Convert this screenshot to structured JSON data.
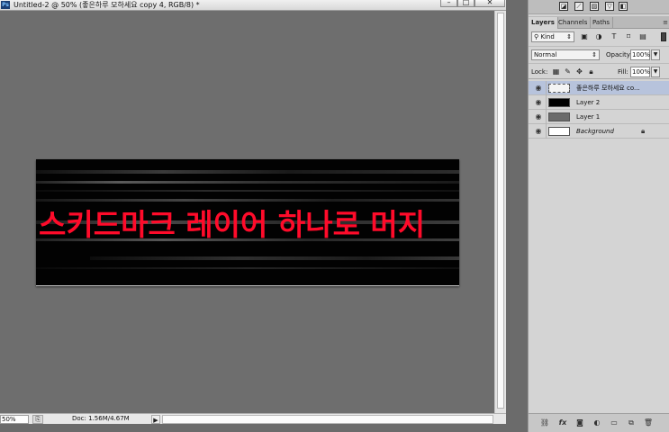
{
  "document": {
    "app_badge": "Ps",
    "title": "Untitled-2 @ 50% (좋은하루 모하세요 copy 4, RGB/8) *",
    "window_buttons": {
      "minimize": "–",
      "maximize": "□",
      "close": "✕"
    },
    "image_text": "스키드마크 레이어 하나로 머지",
    "image_text_color": "#ff0b2a",
    "status": {
      "zoom": "50%",
      "doc_size": "Doc: 1.56M/4.67M",
      "arrow": "▶"
    }
  },
  "panel": {
    "adjustment_icons": [
      "brightness-icon",
      "curves-icon",
      "gradient-map-icon",
      "vibrance-icon",
      "bw-icon"
    ],
    "tabs": [
      "Layers",
      "Channels",
      "Paths"
    ],
    "active_tab": "Layers",
    "filter": {
      "kind_label": "Kind",
      "icons": [
        "pixel-filter-icon",
        "adjustment-filter-icon",
        "type-filter-icon",
        "shape-filter-icon",
        "smart-object-filter-icon"
      ]
    },
    "blend_mode": "Normal",
    "opacity_label": "Opacity:",
    "opacity": "100%",
    "lock_label": "Lock:",
    "fill_label": "Fill:",
    "fill": "100%",
    "layers": [
      {
        "name": "좋은하루 모하세요 co...",
        "thumb": "text",
        "selected": true,
        "visible": true,
        "locked": false
      },
      {
        "name": "Layer 2",
        "thumb": "#000000",
        "selected": false,
        "visible": true,
        "locked": false
      },
      {
        "name": "Layer 1",
        "thumb": "#6b6b6b",
        "selected": false,
        "visible": true,
        "locked": false
      },
      {
        "name": "Background",
        "thumb": "#ffffff",
        "selected": false,
        "visible": true,
        "locked": true
      }
    ],
    "bottom_icons": [
      "link-layers-icon",
      "fx-icon",
      "add-mask-icon",
      "new-adjustment-icon",
      "new-group-icon",
      "new-layer-icon",
      "trash-icon"
    ]
  }
}
